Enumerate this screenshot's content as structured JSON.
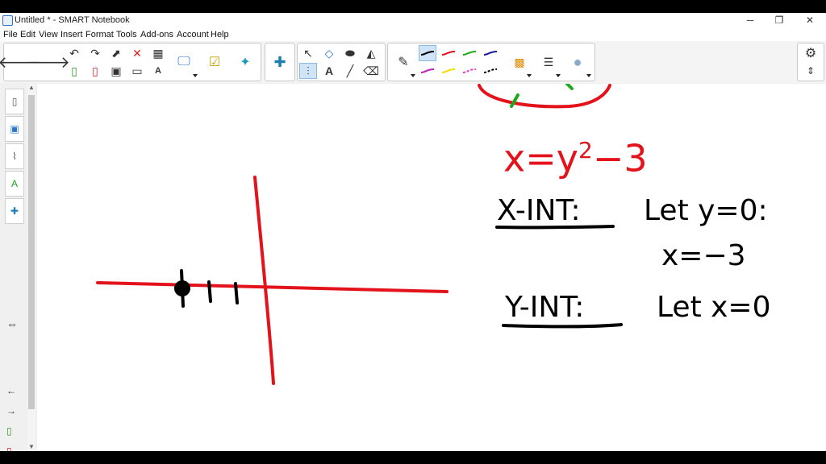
{
  "window": {
    "title": "Untitled * - SMART Notebook",
    "minimize_glyph": "─",
    "restore_glyph": "❐",
    "close_glyph": "✕"
  },
  "menu": [
    "File",
    "Edit",
    "View",
    "Insert",
    "Format",
    "Tools",
    "Add-ons",
    "Account",
    "Help"
  ],
  "colors": {
    "red_ink": "#e3121b",
    "black_ink": "#000000",
    "green_ink": "#1ea81e",
    "accent": "#2a74c9"
  },
  "board": {
    "equation": {
      "x": "x",
      "equals": "=",
      "y": "y",
      "exp": "2",
      "minus": "−",
      "const": "3"
    },
    "x_int": {
      "label": "X-INT:",
      "step1": "Let y=0:",
      "step2": "x=−3"
    },
    "y_int": {
      "label": "Y-INT:",
      "step1": "Let x=0"
    }
  }
}
